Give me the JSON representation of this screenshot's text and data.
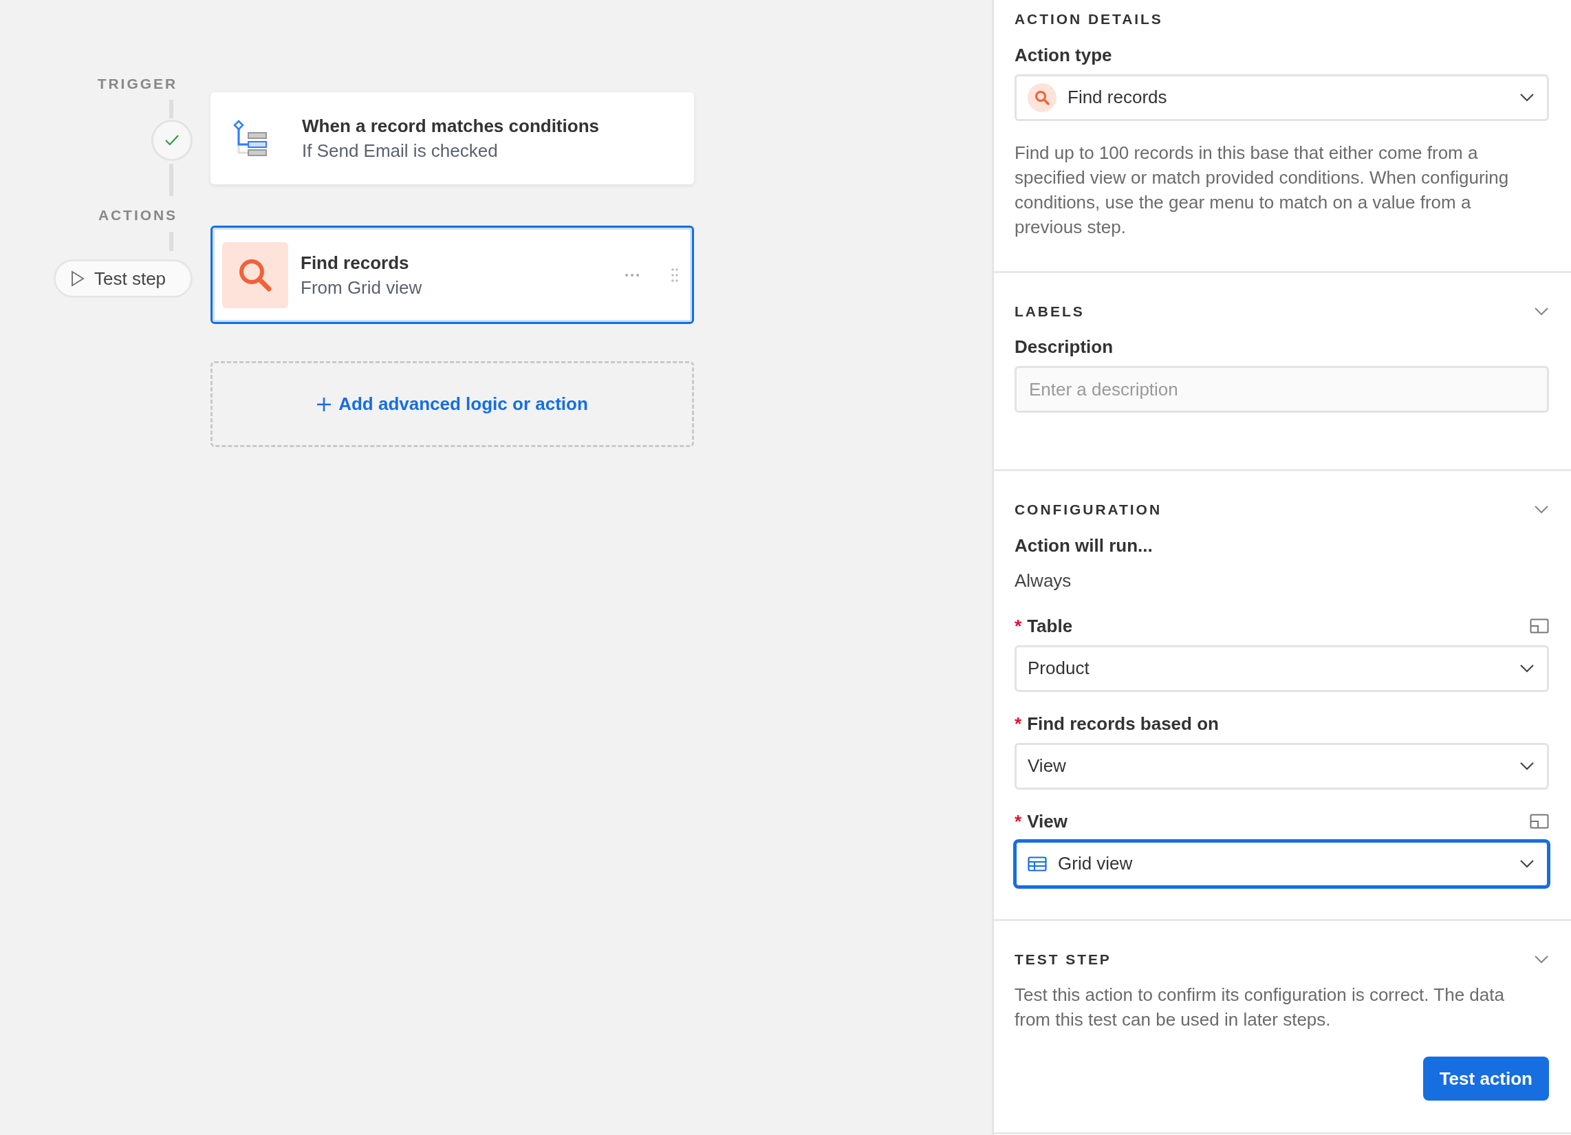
{
  "flow": {
    "trigger_label": "TRIGGER",
    "trigger": {
      "title": "When a record matches conditions",
      "subtitle": "If Send Email is checked",
      "selected": false
    },
    "actions_label": "ACTIONS",
    "test_step_button": "Test step",
    "actions": [
      {
        "title": "Find records",
        "subtitle": "From Grid view",
        "selected": true
      }
    ],
    "add_button": "Add advanced logic or action"
  },
  "panel": {
    "sections": [
      {
        "heading": "ACTION DETAILS",
        "collapsible": false,
        "items": [
          {
            "kind": "search_select",
            "label": "Action type",
            "expand_icon": false,
            "value": "Find records",
            "focused": false
          },
          {
            "kind": "text",
            "text": "Find up to 100 records in this base that either come from a specified view or match provided conditions. When configuring conditions, use the gear menu to match on a value from a previous step."
          }
        ]
      },
      {
        "heading": "LABELS",
        "collapsible": true,
        "items": [
          {
            "kind": "input",
            "label": "Description",
            "placeholder": "Enter a description"
          }
        ]
      },
      {
        "heading": "CONFIGURATION",
        "collapsible": true,
        "items": [
          {
            "kind": "value",
            "label": "Action will run...",
            "value": "Always"
          },
          {
            "kind": "select",
            "required_mark": "*",
            "label": "Table",
            "expand_icon": true,
            "value": "Product",
            "focused": false
          },
          {
            "kind": "select",
            "required_mark": "*",
            "label": "Find records based on",
            "expand_icon": false,
            "value": "View",
            "focused": false
          },
          {
            "kind": "grid_select",
            "required_mark": "*",
            "label": "View",
            "expand_icon": true,
            "value": "Grid view",
            "focused": true
          }
        ]
      },
      {
        "heading": "TEST STEP",
        "collapsible": true,
        "items": [
          {
            "kind": "text",
            "text": "Test this action to confirm its configuration is correct. The data from this test can be used in later steps."
          },
          {
            "kind": "button",
            "label": "Test action"
          }
        ]
      }
    ]
  }
}
